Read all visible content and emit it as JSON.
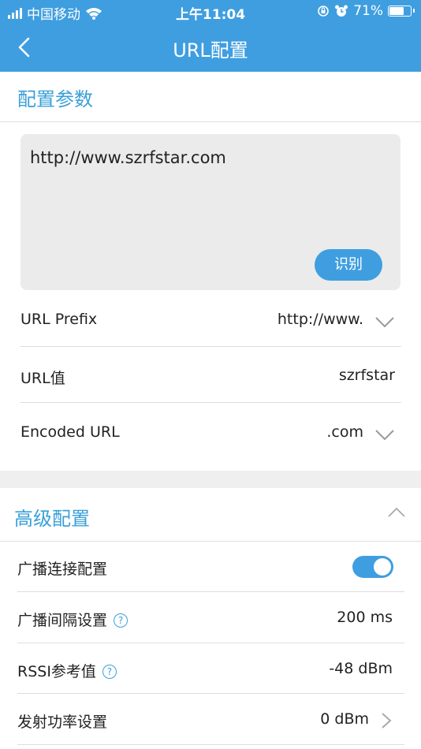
{
  "status": {
    "carrier": "中国移动",
    "time": "上午11:04",
    "battery": "71%",
    "battery_level": 0.71
  },
  "nav": {
    "back_icon": "chevron-left-icon",
    "title": "URL配置"
  },
  "config_section": {
    "title": "配置参数",
    "url_text": "http://www.szrfstar.com",
    "recognize_label": "识别",
    "rows": [
      {
        "label": "URL Prefix",
        "value": "http://www."
      },
      {
        "label": "URL值",
        "value": "szrfstar"
      },
      {
        "label": "Encoded URL",
        "value": ".com"
      }
    ]
  },
  "advanced_section": {
    "title": "高级配置",
    "rows": [
      {
        "label": "广播连接配置",
        "toggle_on": true
      },
      {
        "label": "广播间隔设置",
        "value": "200 ms",
        "help": "?"
      },
      {
        "label": "RSSI参考值",
        "value": "-48 dBm",
        "help": "?"
      },
      {
        "label": "发射功率设置",
        "value": "0 dBm"
      }
    ]
  },
  "colors": {
    "accent": "#3f9ee0",
    "section_title": "#3aa0d8"
  }
}
